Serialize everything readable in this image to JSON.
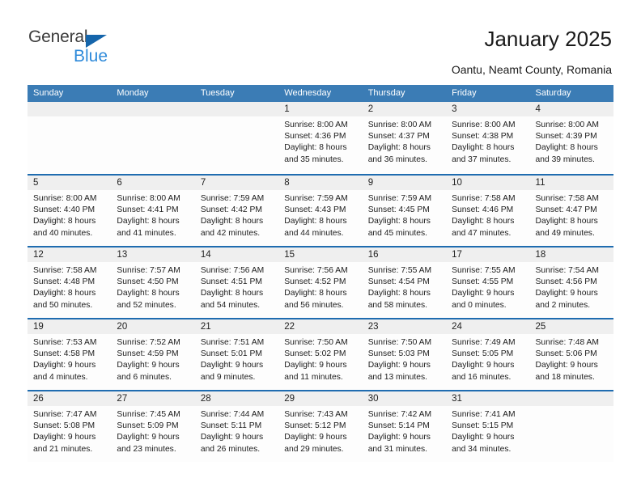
{
  "brand": {
    "name_part1": "General",
    "name_part2": "Blue",
    "accent_color": "#2e8ada",
    "triangle_color": "#1565ab"
  },
  "header": {
    "title": "January 2025",
    "subtitle": "Oantu, Neamt County, Romania"
  },
  "theme": {
    "header_row_bg": "#3b7cb5",
    "week_divider": "#1f6cb0",
    "daynum_strip_bg": "#efefef",
    "text_color": "#1c1c1c"
  },
  "calendar": {
    "day_headers": [
      "Sunday",
      "Monday",
      "Tuesday",
      "Wednesday",
      "Thursday",
      "Friday",
      "Saturday"
    ],
    "labels": {
      "sunrise_prefix": "Sunrise:",
      "sunset_prefix": "Sunset:",
      "daylight_prefix": "Daylight:"
    },
    "weeks": [
      [
        {
          "day": "",
          "empty": true,
          "lines": []
        },
        {
          "day": "",
          "empty": true,
          "lines": []
        },
        {
          "day": "",
          "empty": true,
          "lines": []
        },
        {
          "day": "1",
          "empty": false,
          "lines": [
            "Sunrise: 8:00 AM",
            "Sunset: 4:36 PM",
            "Daylight: 8 hours",
            "and 35 minutes."
          ]
        },
        {
          "day": "2",
          "empty": false,
          "lines": [
            "Sunrise: 8:00 AM",
            "Sunset: 4:37 PM",
            "Daylight: 8 hours",
            "and 36 minutes."
          ]
        },
        {
          "day": "3",
          "empty": false,
          "lines": [
            "Sunrise: 8:00 AM",
            "Sunset: 4:38 PM",
            "Daylight: 8 hours",
            "and 37 minutes."
          ]
        },
        {
          "day": "4",
          "empty": false,
          "lines": [
            "Sunrise: 8:00 AM",
            "Sunset: 4:39 PM",
            "Daylight: 8 hours",
            "and 39 minutes."
          ]
        }
      ],
      [
        {
          "day": "5",
          "empty": false,
          "lines": [
            "Sunrise: 8:00 AM",
            "Sunset: 4:40 PM",
            "Daylight: 8 hours",
            "and 40 minutes."
          ]
        },
        {
          "day": "6",
          "empty": false,
          "lines": [
            "Sunrise: 8:00 AM",
            "Sunset: 4:41 PM",
            "Daylight: 8 hours",
            "and 41 minutes."
          ]
        },
        {
          "day": "7",
          "empty": false,
          "lines": [
            "Sunrise: 7:59 AM",
            "Sunset: 4:42 PM",
            "Daylight: 8 hours",
            "and 42 minutes."
          ]
        },
        {
          "day": "8",
          "empty": false,
          "lines": [
            "Sunrise: 7:59 AM",
            "Sunset: 4:43 PM",
            "Daylight: 8 hours",
            "and 44 minutes."
          ]
        },
        {
          "day": "9",
          "empty": false,
          "lines": [
            "Sunrise: 7:59 AM",
            "Sunset: 4:45 PM",
            "Daylight: 8 hours",
            "and 45 minutes."
          ]
        },
        {
          "day": "10",
          "empty": false,
          "lines": [
            "Sunrise: 7:58 AM",
            "Sunset: 4:46 PM",
            "Daylight: 8 hours",
            "and 47 minutes."
          ]
        },
        {
          "day": "11",
          "empty": false,
          "lines": [
            "Sunrise: 7:58 AM",
            "Sunset: 4:47 PM",
            "Daylight: 8 hours",
            "and 49 minutes."
          ]
        }
      ],
      [
        {
          "day": "12",
          "empty": false,
          "lines": [
            "Sunrise: 7:58 AM",
            "Sunset: 4:48 PM",
            "Daylight: 8 hours",
            "and 50 minutes."
          ]
        },
        {
          "day": "13",
          "empty": false,
          "lines": [
            "Sunrise: 7:57 AM",
            "Sunset: 4:50 PM",
            "Daylight: 8 hours",
            "and 52 minutes."
          ]
        },
        {
          "day": "14",
          "empty": false,
          "lines": [
            "Sunrise: 7:56 AM",
            "Sunset: 4:51 PM",
            "Daylight: 8 hours",
            "and 54 minutes."
          ]
        },
        {
          "day": "15",
          "empty": false,
          "lines": [
            "Sunrise: 7:56 AM",
            "Sunset: 4:52 PM",
            "Daylight: 8 hours",
            "and 56 minutes."
          ]
        },
        {
          "day": "16",
          "empty": false,
          "lines": [
            "Sunrise: 7:55 AM",
            "Sunset: 4:54 PM",
            "Daylight: 8 hours",
            "and 58 minutes."
          ]
        },
        {
          "day": "17",
          "empty": false,
          "lines": [
            "Sunrise: 7:55 AM",
            "Sunset: 4:55 PM",
            "Daylight: 9 hours",
            "and 0 minutes."
          ]
        },
        {
          "day": "18",
          "empty": false,
          "lines": [
            "Sunrise: 7:54 AM",
            "Sunset: 4:56 PM",
            "Daylight: 9 hours",
            "and 2 minutes."
          ]
        }
      ],
      [
        {
          "day": "19",
          "empty": false,
          "lines": [
            "Sunrise: 7:53 AM",
            "Sunset: 4:58 PM",
            "Daylight: 9 hours",
            "and 4 minutes."
          ]
        },
        {
          "day": "20",
          "empty": false,
          "lines": [
            "Sunrise: 7:52 AM",
            "Sunset: 4:59 PM",
            "Daylight: 9 hours",
            "and 6 minutes."
          ]
        },
        {
          "day": "21",
          "empty": false,
          "lines": [
            "Sunrise: 7:51 AM",
            "Sunset: 5:01 PM",
            "Daylight: 9 hours",
            "and 9 minutes."
          ]
        },
        {
          "day": "22",
          "empty": false,
          "lines": [
            "Sunrise: 7:50 AM",
            "Sunset: 5:02 PM",
            "Daylight: 9 hours",
            "and 11 minutes."
          ]
        },
        {
          "day": "23",
          "empty": false,
          "lines": [
            "Sunrise: 7:50 AM",
            "Sunset: 5:03 PM",
            "Daylight: 9 hours",
            "and 13 minutes."
          ]
        },
        {
          "day": "24",
          "empty": false,
          "lines": [
            "Sunrise: 7:49 AM",
            "Sunset: 5:05 PM",
            "Daylight: 9 hours",
            "and 16 minutes."
          ]
        },
        {
          "day": "25",
          "empty": false,
          "lines": [
            "Sunrise: 7:48 AM",
            "Sunset: 5:06 PM",
            "Daylight: 9 hours",
            "and 18 minutes."
          ]
        }
      ],
      [
        {
          "day": "26",
          "empty": false,
          "lines": [
            "Sunrise: 7:47 AM",
            "Sunset: 5:08 PM",
            "Daylight: 9 hours",
            "and 21 minutes."
          ]
        },
        {
          "day": "27",
          "empty": false,
          "lines": [
            "Sunrise: 7:45 AM",
            "Sunset: 5:09 PM",
            "Daylight: 9 hours",
            "and 23 minutes."
          ]
        },
        {
          "day": "28",
          "empty": false,
          "lines": [
            "Sunrise: 7:44 AM",
            "Sunset: 5:11 PM",
            "Daylight: 9 hours",
            "and 26 minutes."
          ]
        },
        {
          "day": "29",
          "empty": false,
          "lines": [
            "Sunrise: 7:43 AM",
            "Sunset: 5:12 PM",
            "Daylight: 9 hours",
            "and 29 minutes."
          ]
        },
        {
          "day": "30",
          "empty": false,
          "lines": [
            "Sunrise: 7:42 AM",
            "Sunset: 5:14 PM",
            "Daylight: 9 hours",
            "and 31 minutes."
          ]
        },
        {
          "day": "31",
          "empty": false,
          "lines": [
            "Sunrise: 7:41 AM",
            "Sunset: 5:15 PM",
            "Daylight: 9 hours",
            "and 34 minutes."
          ]
        },
        {
          "day": "",
          "empty": true,
          "lines": []
        }
      ]
    ]
  }
}
